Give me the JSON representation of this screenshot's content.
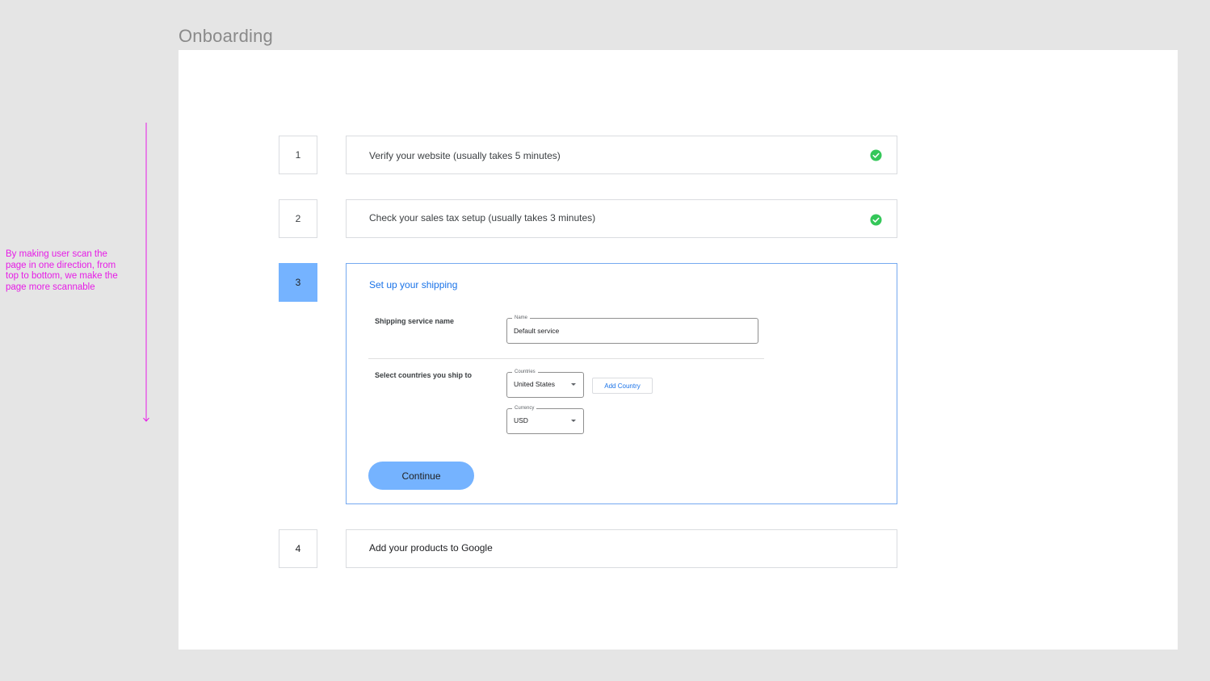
{
  "frame_title": "Onboarding",
  "annotation": {
    "text": "By making user scan the page in one direction, from top to bottom, we make the page more scannable",
    "color": "#e61ce6"
  },
  "steps": [
    {
      "number": "1",
      "label": "Verify your website (usually takes 5 minutes)",
      "status": "complete",
      "icon": "check-circle-icon"
    },
    {
      "number": "2",
      "label": "Check your sales tax setup (usually takes 3 minutes)",
      "status": "complete",
      "icon": "check-circle-icon"
    },
    {
      "number": "3",
      "label": "Set up your shipping",
      "status": "active"
    },
    {
      "number": "4",
      "label": "Add your products to Google",
      "status": "pending"
    }
  ],
  "shipping_form": {
    "service_name_label": "Shipping service name",
    "name_field": {
      "legend": "Name",
      "value": "Default service"
    },
    "countries_label": "Select countries you ship to",
    "countries_field": {
      "legend": "Countries",
      "value": "United States"
    },
    "add_country_label": "Add Country",
    "currency_field": {
      "legend": "Currency",
      "value": "USD"
    },
    "continue_label": "Continue"
  },
  "colors": {
    "accent": "#75b3ff",
    "link": "#1a73e8",
    "success": "#34c759",
    "background": "#e5e5e5"
  }
}
